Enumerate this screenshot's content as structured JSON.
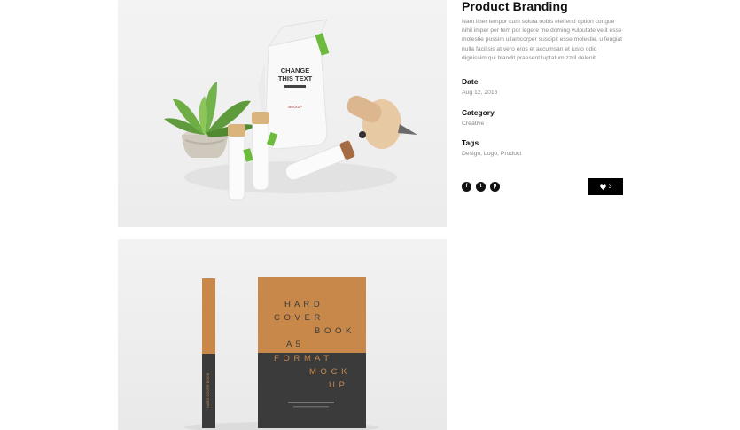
{
  "project": {
    "title": "Product Branding",
    "description": "Nam liber tempor cum soluta nobis eleifend option congue nihil imper per tem por legere me doming vulputate velit esse molestie possim ullamcorper suscipit esse molestie. u feugiat nulla facilisis at vero eros et accumsan et iusto odio dignissim qui blandit praesent luptatum zzril delenit",
    "date_label": "Date",
    "date_value": "Aug 12, 2016",
    "category_label": "Category",
    "category_value": "Creative",
    "tags_label": "Tags",
    "tags_value": "Design, Logo, Product"
  },
  "share": {
    "icons": [
      "facebook-icon",
      "twitter-icon",
      "pinterest-icon"
    ],
    "glyphs": [
      "f",
      "t",
      "p"
    ]
  },
  "like": {
    "icon": "heart-icon",
    "count": "3"
  },
  "mockup_bag": {
    "label_line1": "CHANGE",
    "label_line2": "THIS TEXT",
    "tag": "MOCKUP"
  },
  "mockup_book": {
    "lines": [
      "H A R D",
      "C O V E R",
      "B O O K",
      "A 5",
      "F O R M A T",
      "M O C K",
      "U P"
    ],
    "spine_text": "HARD COVER BOOK"
  },
  "colors": {
    "accent_green": "#6cbb3c",
    "book_orange": "#c8884a",
    "book_dark": "#3b3b3c",
    "button_bg": "#000000"
  }
}
